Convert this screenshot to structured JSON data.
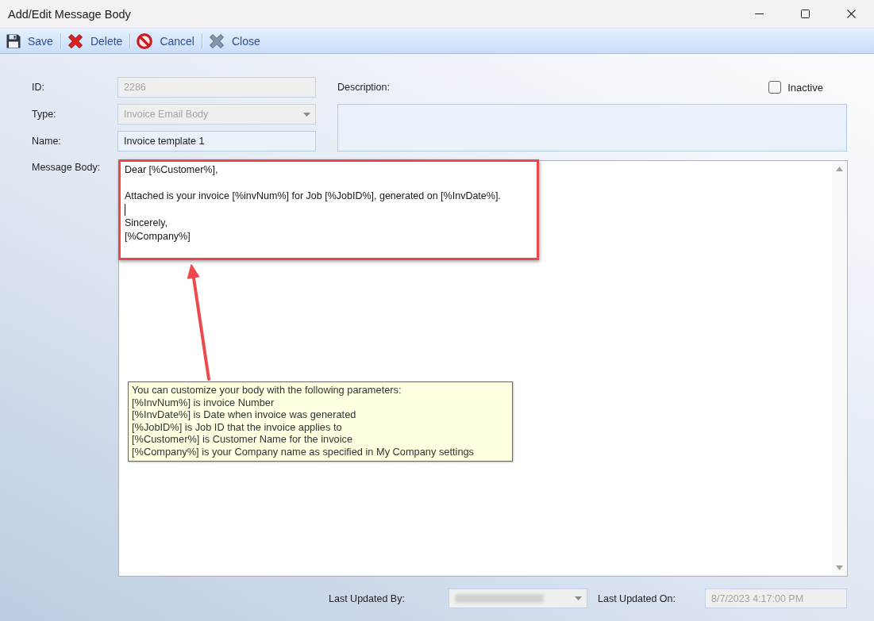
{
  "window": {
    "title": "Add/Edit Message Body"
  },
  "toolbar": [
    {
      "kind": "save",
      "label": "Save"
    },
    {
      "kind": "delete",
      "label": "Delete"
    },
    {
      "kind": "cancel",
      "label": "Cancel"
    },
    {
      "kind": "close",
      "label": "Close"
    }
  ],
  "form": {
    "fields": [
      {
        "kind": "text",
        "label": "ID:",
        "value": "2286",
        "disabled": true
      },
      {
        "kind": "combo",
        "label": "Type:",
        "value": "Invoice Email Body",
        "disabled": true
      },
      {
        "kind": "text",
        "label": "Name:",
        "value": "Invoice template 1",
        "disabled": false
      }
    ],
    "description": {
      "label": "Description:"
    },
    "inactive": {
      "label": "Inactive",
      "checked": false
    }
  },
  "message_body": {
    "label": "Message Body:",
    "lines": [
      {
        "kind": "text",
        "text": "Dear [%Customer%],"
      },
      {
        "kind": "blank"
      },
      {
        "kind": "text",
        "text": "Attached is your invoice [%invNum%] for Job [%JobID%], generated on [%InvDate%]."
      },
      {
        "kind": "caret"
      },
      {
        "kind": "text",
        "text": "Sincerely,"
      },
      {
        "kind": "text",
        "text": "[%Company%]"
      }
    ]
  },
  "tooltip": {
    "lines": [
      "You can customize your body with the following parameters:",
      "[%InvNum%] is invoice Number",
      "[%InvDate%] is Date when invoice was generated",
      "[%JobID%] is Job ID that the invoice applies to",
      "[%Customer%] is Customer Name for the invoice",
      "[%Company%] is your Company name as specified in My Company settings"
    ]
  },
  "footer": [
    {
      "kind": "combo",
      "label": "Last Updated By:",
      "disabled": true,
      "redacted": true
    },
    {
      "kind": "text",
      "label": "Last Updated On:",
      "value": "8/7/2023 4:17:00 PM",
      "disabled": true
    }
  ]
}
